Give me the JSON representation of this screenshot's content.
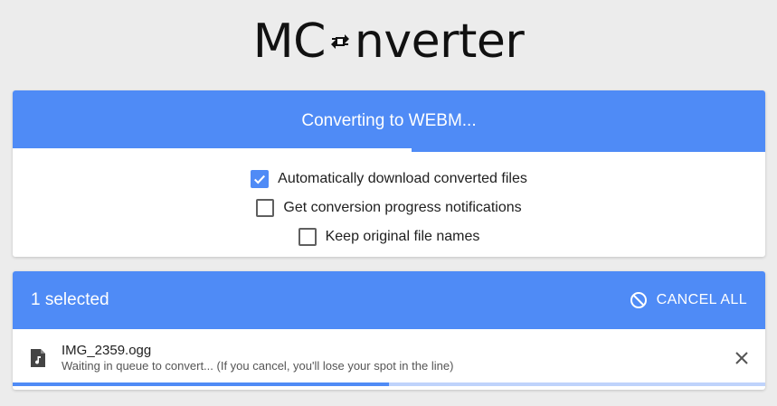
{
  "logo": {
    "prefix": "MC",
    "suffix": "nverter",
    "icon": "convert-arrows-icon"
  },
  "converter": {
    "status_text": "Converting to WEBM...",
    "progress": 0.53,
    "options": [
      {
        "label": "Automatically download converted files",
        "checked": true
      },
      {
        "label": "Get conversion progress notifications",
        "checked": false
      },
      {
        "label": "Keep original file names",
        "checked": false
      }
    ]
  },
  "queue": {
    "selected_text": "1 selected",
    "cancel_all_label": "CANCEL ALL",
    "cancel_icon": "ban-icon",
    "files": [
      {
        "name": "IMG_2359.ogg",
        "status": "Waiting in queue to convert... (If you cancel, you'll lose your spot in the line)",
        "icon": "audio-file-icon",
        "progress": 0.5
      }
    ]
  },
  "colors": {
    "accent": "#4f8bf6",
    "accent_light": "#bfd3fb",
    "background": "#ececec"
  }
}
